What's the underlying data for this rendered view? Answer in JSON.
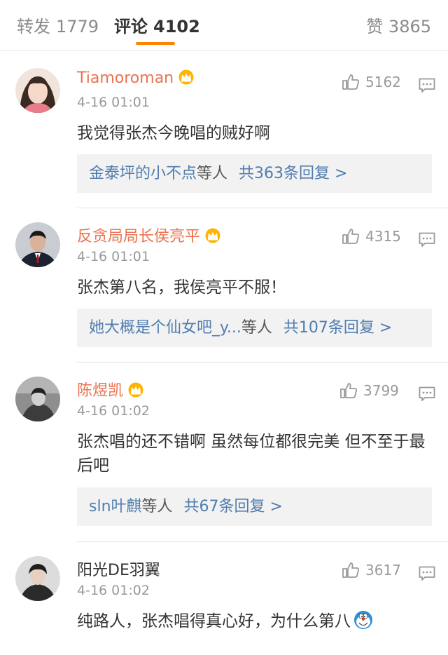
{
  "tabs": {
    "repost": {
      "label": "转发",
      "count": "1779"
    },
    "comments": {
      "label": "评论",
      "count": "4102"
    },
    "likes": {
      "label": "赞",
      "count": "3865"
    }
  },
  "colors": {
    "accent": "#ff8200",
    "vip_name": "#eb7350",
    "reply_link": "#507daf"
  },
  "comments": [
    {
      "user": "Tiamoroman",
      "vip": true,
      "time": "4-16 01:01",
      "likes": "5162",
      "text": "我觉得张杰今晚唱的贼好啊",
      "reply_users": "金泰坪的小不点",
      "reply_suffix": "等人",
      "reply_total": "共363条回复 >"
    },
    {
      "user": "反贪局局长侯亮平",
      "vip": true,
      "time": "4-16 01:01",
      "likes": "4315",
      "text": "张杰第八名，我侯亮平不服！",
      "reply_users": "她大概是个仙女吧_y...",
      "reply_suffix": "等人",
      "reply_total": "共107条回复 >"
    },
    {
      "user": "陈煜凯",
      "vip": true,
      "time": "4-16 01:02",
      "likes": "3799",
      "text": "张杰唱的还不错啊 虽然每位都很完美 但不至于最后吧",
      "reply_users": "sln叶麒",
      "reply_suffix": "等人",
      "reply_total": "共67条回复 >"
    },
    {
      "user": "阳光DE羽翼",
      "vip": false,
      "time": "4-16 01:02",
      "likes": "3617",
      "text": "纯路人，张杰唱得真心好，为什么第八",
      "emoji": "doraemon-face-icon"
    }
  ]
}
